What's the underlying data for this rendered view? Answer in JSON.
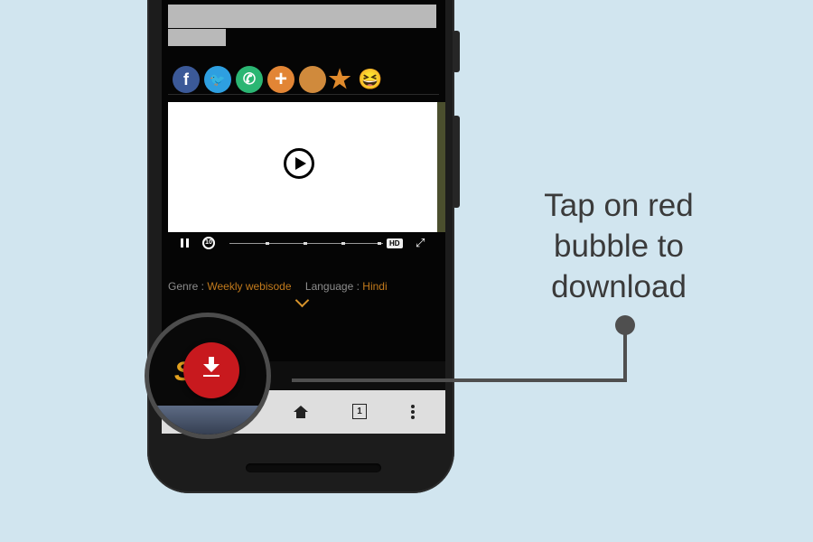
{
  "share_icons": [
    {
      "name": "facebook-icon",
      "glyph": "f",
      "color": "#3b5998"
    },
    {
      "name": "twitter-icon",
      "glyph": "🐦",
      "color": "#2e9fe0"
    },
    {
      "name": "whatsapp-icon",
      "glyph": "✆",
      "color": "#2bb673"
    },
    {
      "name": "plus-icon",
      "glyph": "+",
      "color": "#e28535"
    },
    {
      "name": "watch-icon",
      "glyph": "",
      "color": "#d08a3c"
    },
    {
      "name": "star-icon",
      "glyph": "★",
      "color": "transparent"
    },
    {
      "name": "emoji-icon",
      "glyph": "😆",
      "color": "transparent"
    }
  ],
  "player": {
    "replay_label": "10",
    "quality": "HD",
    "expand_glyph": "⤢"
  },
  "meta": {
    "genre_label": "Genre :",
    "genre_value": "Weekly webisode",
    "language_label": "Language :",
    "language_value": "Hindi"
  },
  "lens": {
    "show_text": "Sr Vi"
  },
  "navbar": {
    "tabs_count": "1"
  },
  "callout": {
    "line1": "Tap on red",
    "line2": "bubble to",
    "line3": "download"
  },
  "colors": {
    "background": "#d1e5ef",
    "bubble": "#c8191e",
    "accent": "#c27a1c"
  }
}
